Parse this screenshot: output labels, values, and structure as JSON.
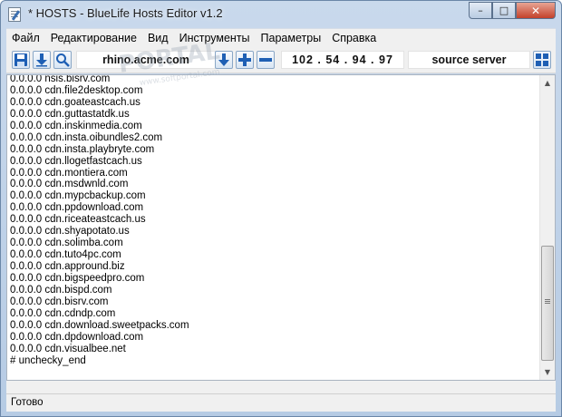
{
  "window": {
    "title": "* HOSTS - BlueLife Hosts Editor v1.2"
  },
  "caption_buttons": {
    "minimize": "–",
    "maximize": "□",
    "close": "✕"
  },
  "menu": [
    "Файл",
    "Редактирование",
    "Вид",
    "Инструменты",
    "Параметры",
    "Справка"
  ],
  "toolbar": {
    "hostname": "rhino.acme.com",
    "ip_address": "102  .  54  .  94  .  97",
    "source_field": "source server",
    "icons": [
      "save-icon",
      "download-icon",
      "search-icon",
      "move-down-icon",
      "add-icon",
      "remove-icon",
      "grid-icon"
    ]
  },
  "editor": {
    "lines": [
      "0.0.0.0 nsis.bisrv.com",
      "0.0.0.0 cdn.file2desktop.com",
      "0.0.0.0 cdn.goateastcach.us",
      "0.0.0.0 cdn.guttastatdk.us",
      "0.0.0.0 cdn.inskinmedia.com",
      "0.0.0.0 cdn.insta.oibundles2.com",
      "0.0.0.0 cdn.insta.playbryte.com",
      "0.0.0.0 cdn.llogetfastcach.us",
      "0.0.0.0 cdn.montiera.com",
      "0.0.0.0 cdn.msdwnld.com",
      "0.0.0.0 cdn.mypcbackup.com",
      "0.0.0.0 cdn.ppdownload.com",
      "0.0.0.0 cdn.riceateastcach.us",
      "0.0.0.0 cdn.shyapotato.us",
      "0.0.0.0 cdn.solimba.com",
      "0.0.0.0 cdn.tuto4pc.com",
      "0.0.0.0 cdn.appround.biz",
      "0.0.0.0 cdn.bigspeedpro.com",
      "0.0.0.0 cdn.bispd.com",
      "0.0.0.0 cdn.bisrv.com",
      "0.0.0.0 cdn.cdndp.com",
      "0.0.0.0 cdn.download.sweetpacks.com",
      "0.0.0.0 cdn.dpdownload.com",
      "0.0.0.0 cdn.visualbee.net",
      "# unchecky_end"
    ]
  },
  "status": {
    "text": "Готово"
  },
  "watermark": {
    "text": "PORTAL",
    "subtext": "www.softportal.com"
  },
  "colors": {
    "accent": "#1e5fb4",
    "close_button": "#c3412b",
    "toolbar_bg": "#f0f0f0"
  }
}
